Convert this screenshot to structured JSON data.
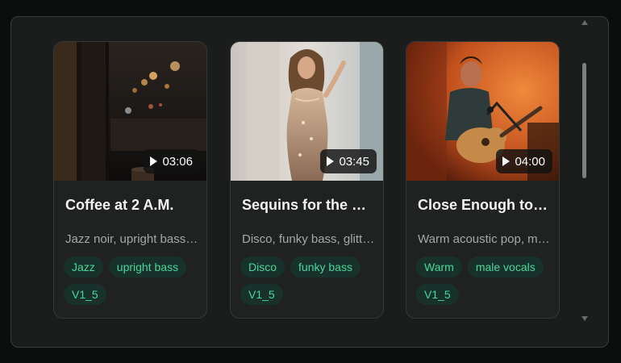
{
  "cards": [
    {
      "title": "Coffee at 2 A.M.",
      "description": "Jazz noir, upright bass, smoky late-night cafe",
      "duration": "03:06",
      "tags": [
        "Jazz",
        "upright bass",
        "V1_5"
      ]
    },
    {
      "title": "Sequins for the Saturday Night",
      "description": "Disco, funky bass, glittering dance floor",
      "duration": "03:45",
      "tags": [
        "Disco",
        "funky bass",
        "V1_5"
      ]
    },
    {
      "title": "Close Enough to Home",
      "description": "Warm acoustic pop, male vocals",
      "duration": "04:00",
      "tags": [
        "Warm",
        "male vocals",
        "V1_5"
      ]
    }
  ],
  "colors": {
    "tag_text": "#49d79f",
    "tag_bg": "#18312a",
    "panel_bg": "#1b1c1c"
  }
}
